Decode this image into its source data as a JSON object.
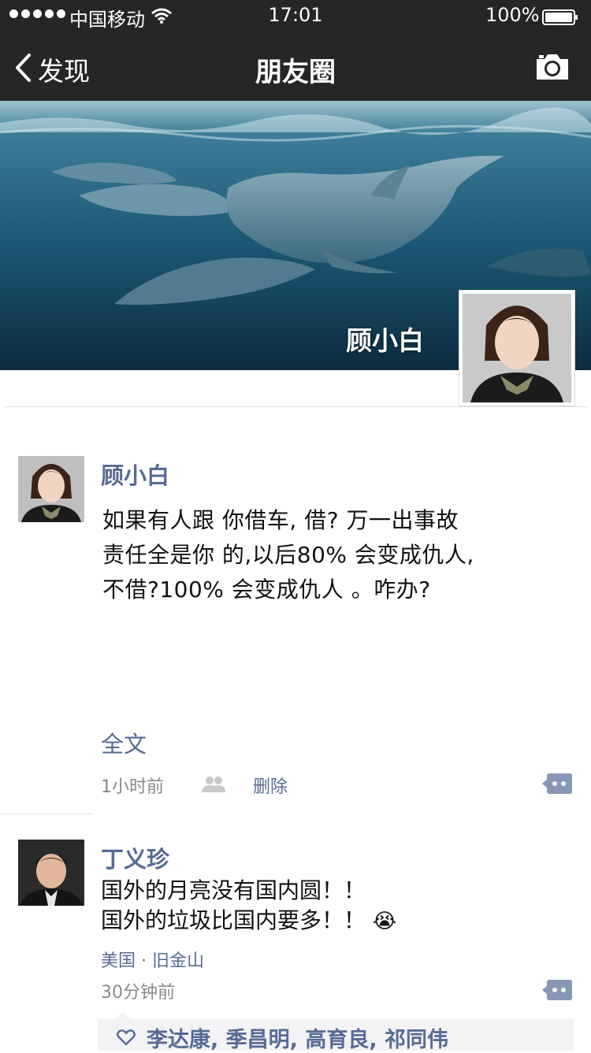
{
  "status_bar": {
    "carrier": "中国移动",
    "time": "17:01",
    "battery": "100%"
  },
  "nav": {
    "back_label": "发现",
    "title": "朋友圈"
  },
  "profile": {
    "name": "顾小白"
  },
  "posts": [
    {
      "author": "顾小白",
      "text": "如果有人跟 你借车, 借? 万一出事故\n责任全是你 的,以后80% 会变成仇人,\n不借?100% 会变成仇人 。咋办?",
      "expand_label": "全文",
      "time": "1小时前",
      "delete_label": "删除"
    },
    {
      "author": "丁义珍",
      "text": "国外的月亮没有国内圆！！\n国外的垃圾比国内要多！！",
      "emoji": "😭",
      "location": "美国 · 旧金山",
      "time": "30分钟前",
      "likes": "李达康, 季昌明, 高育良, 祁同伟"
    }
  ],
  "colors": {
    "bar": "#262626",
    "link": "#576b95",
    "meta": "#8a8a8a",
    "likes_bg": "#f3f3f5"
  },
  "icons": [
    "signal-icon",
    "wifi-icon",
    "battery-icon",
    "back-chevron-icon",
    "camera-icon",
    "friends-icon",
    "comment-icon",
    "heart-icon"
  ]
}
